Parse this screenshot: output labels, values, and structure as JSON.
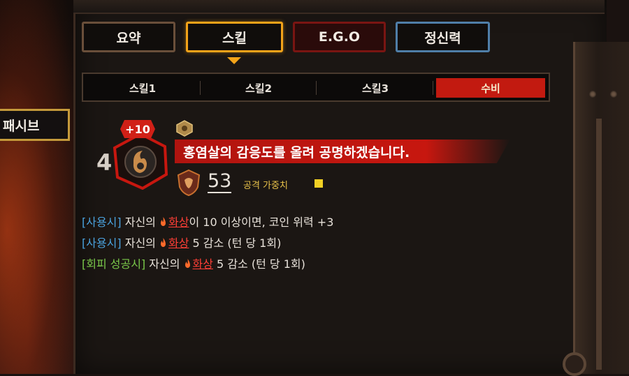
{
  "tabs": {
    "summary": "요약",
    "skill": "스킬",
    "ego": "E.G.O",
    "mental": "정신력"
  },
  "subtabs": [
    "스킬1",
    "스킬2",
    "스킬3",
    "수비"
  ],
  "side": {
    "passive": "패시브"
  },
  "skill": {
    "level": "4",
    "plus": "+10",
    "name": "홍염살의 감응도를 올려 공명하겠습니다.",
    "power": "53",
    "weight_label": "공격 가중치"
  },
  "effects": [
    {
      "tag": "[사용시]",
      "prefix": " 자신의 ",
      "keyword": "화상",
      "suffix": "이 10 이상이면, 코인 위력 +3"
    },
    {
      "tag": "[사용시]",
      "prefix": " 자신의 ",
      "keyword": "화상",
      "suffix": " 5 감소 (턴 당 1회)"
    },
    {
      "tag": "[회피 성공시]",
      "prefix": " 자신의 ",
      "keyword": "화상",
      "suffix": " 5 감소 (턴 당 1회)"
    }
  ],
  "colors": {
    "skill_tab_border": "#f3a319",
    "ego_tab_border": "#7a1512",
    "mental_tab_border": "#4f7ea8",
    "defense_active": "#c21a10",
    "burn_keyword": "#ff3f36",
    "use_tag": "#4aa3df",
    "evade_tag": "#7ac94a",
    "weight_color": "#f2d024"
  },
  "icons": {
    "skill_icon": "evade-skill-icon",
    "sin": "gluttony-sin-icon",
    "power": "shield-icon",
    "burn": "flame-icon"
  }
}
